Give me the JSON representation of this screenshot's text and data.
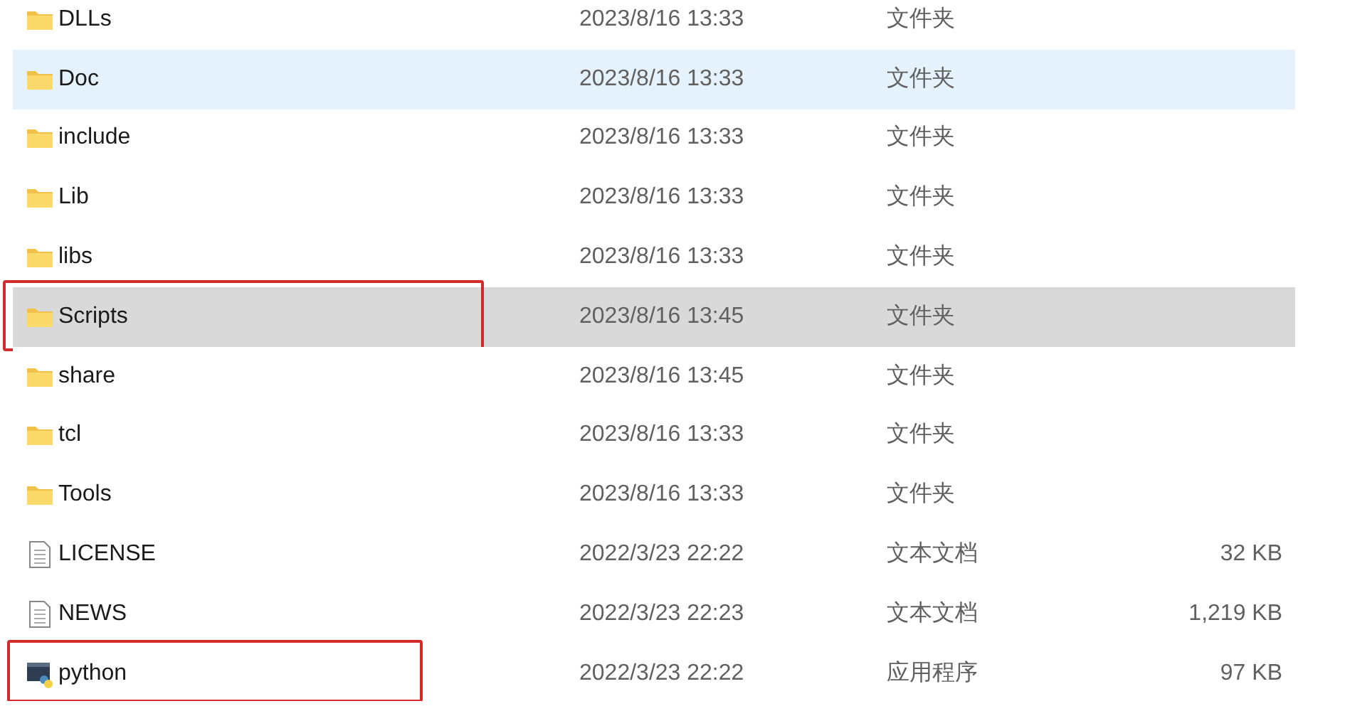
{
  "files": [
    {
      "name": "DLLs",
      "kind": "folder",
      "date": "2023/8/16 13:33",
      "type": "文件夹",
      "selected": false,
      "hovered": false,
      "outlined": false
    },
    {
      "name": "Doc",
      "kind": "folder",
      "date": "2023/8/16 13:33",
      "type": "文件夹",
      "selected": false,
      "hovered": true,
      "outlined": false
    },
    {
      "name": "include",
      "kind": "folder",
      "date": "2023/8/16 13:33",
      "type": "文件夹",
      "selected": false,
      "hovered": false,
      "outlined": false
    },
    {
      "name": "Lib",
      "kind": "folder",
      "date": "2023/8/16 13:33",
      "type": "文件夹",
      "selected": false,
      "hovered": false,
      "outlined": false
    },
    {
      "name": "libs",
      "kind": "folder",
      "date": "2023/8/16 13:33",
      "type": "文件夹",
      "selected": false,
      "hovered": false,
      "outlined": false
    },
    {
      "name": "Scripts",
      "kind": "folder",
      "date": "2023/8/16 13:45",
      "type": "文件夹",
      "selected": true,
      "hovered": false,
      "outlined": true
    },
    {
      "name": "share",
      "kind": "folder",
      "date": "2023/8/16 13:45",
      "type": "文件夹",
      "selected": false,
      "hovered": false,
      "outlined": false
    },
    {
      "name": "tcl",
      "kind": "folder",
      "date": "2023/8/16 13:33",
      "type": "文件夹",
      "selected": false,
      "hovered": false,
      "outlined": false
    },
    {
      "name": "Tools",
      "kind": "folder",
      "date": "2023/8/16 13:33",
      "type": "文件夹",
      "selected": false,
      "hovered": false,
      "outlined": false
    },
    {
      "name": "LICENSE",
      "kind": "text",
      "date": "2022/3/23 22:22",
      "type": "文本文档",
      "size": "32 KB",
      "selected": false,
      "hovered": false,
      "outlined": false
    },
    {
      "name": "NEWS",
      "kind": "text",
      "date": "2022/3/23 22:23",
      "type": "文本文档",
      "size": "1,219 KB",
      "selected": false,
      "hovered": false,
      "outlined": false
    },
    {
      "name": "python",
      "kind": "app",
      "date": "2022/3/23 22:22",
      "type": "应用程序",
      "size": "97 KB",
      "selected": false,
      "hovered": false,
      "outlined": true
    }
  ]
}
